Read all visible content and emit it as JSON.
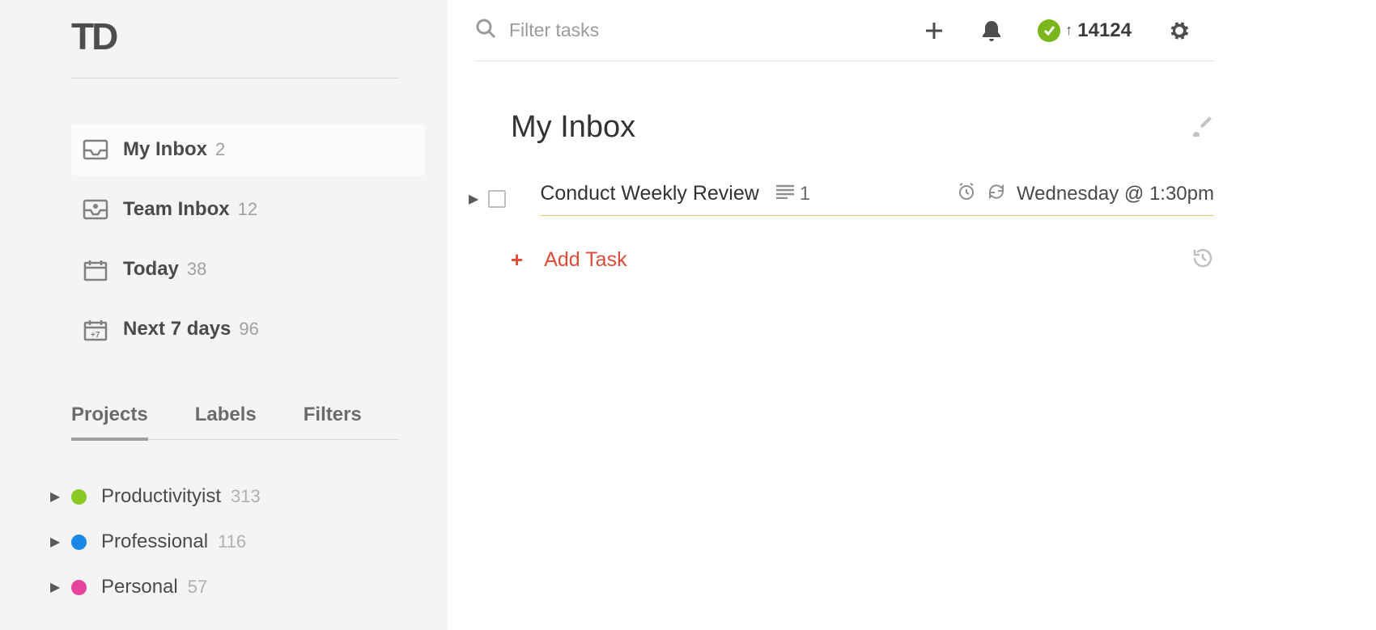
{
  "logo": "TD",
  "sidebar": {
    "nav": [
      {
        "label": "My Inbox",
        "count": "2",
        "active": true,
        "icon": "inbox"
      },
      {
        "label": "Team Inbox",
        "count": "12",
        "active": false,
        "icon": "team"
      },
      {
        "label": "Today",
        "count": "38",
        "active": false,
        "icon": "calendar"
      },
      {
        "label": "Next 7 days",
        "count": "96",
        "active": false,
        "icon": "calendar7"
      }
    ],
    "tabs": [
      {
        "label": "Projects",
        "active": true
      },
      {
        "label": "Labels",
        "active": false
      },
      {
        "label": "Filters",
        "active": false
      }
    ],
    "projects": [
      {
        "label": "Productivityist",
        "count": "313",
        "color": "#8bc924"
      },
      {
        "label": "Professional",
        "count": "116",
        "color": "#1b87e6"
      },
      {
        "label": "Personal",
        "count": "57",
        "color": "#e6439f"
      }
    ]
  },
  "topbar": {
    "search_placeholder": "Filter tasks",
    "karma_score": "14124"
  },
  "main": {
    "title": "My Inbox",
    "task": {
      "title": "Conduct Weekly Review",
      "comment_count": "1",
      "date": "Wednesday @ 1:30pm"
    },
    "add_label": "Add Task"
  }
}
